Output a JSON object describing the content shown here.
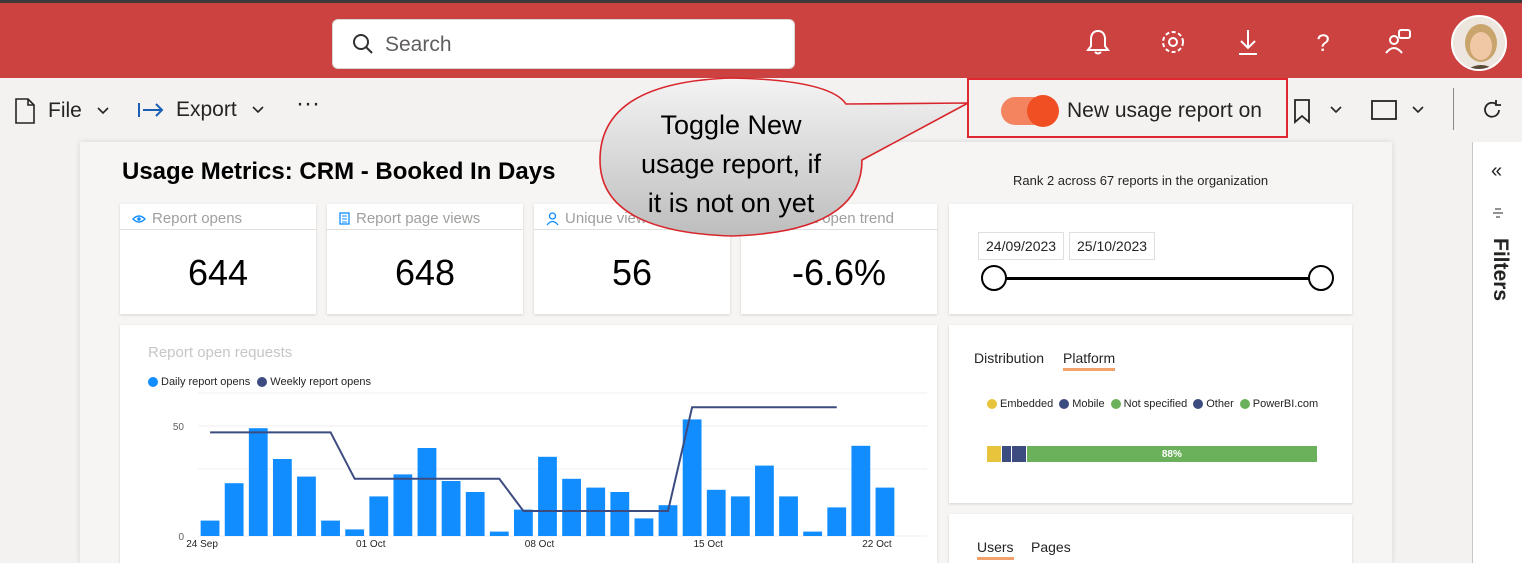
{
  "topbar": {
    "search_placeholder": "Search",
    "icons": [
      "bell-icon",
      "gear-icon",
      "download-icon",
      "help-icon",
      "feedback-icon"
    ],
    "avatar_initials": "",
    "accent_color": "#cc4240"
  },
  "commandbar": {
    "file_label": "File",
    "export_label": "Export",
    "more_label": "···",
    "toggle_label": "New usage report on",
    "toggle_on": true
  },
  "report": {
    "title": "Usage Metrics: CRM - Booked In Days",
    "rank_text": "Rank 2 across 67 reports in the organization",
    "kpis": [
      {
        "label": "Report opens",
        "value": "644",
        "icon": "eye-icon"
      },
      {
        "label": "Report page views",
        "value": "648",
        "icon": "document-icon"
      },
      {
        "label": "Unique viewers",
        "value": "56",
        "icon": "person-icon"
      },
      {
        "label": "Report open trend",
        "value": "-6.6%",
        "icon": "trend-icon"
      }
    ],
    "date_start": "24/09/2023",
    "date_end": "25/10/2023",
    "distribution": {
      "tabs": [
        "Distribution",
        "Platform"
      ],
      "active_tab": "Platform",
      "legend": [
        {
          "name": "Embedded",
          "color": "#e8c43c"
        },
        {
          "name": "Mobile",
          "color": "#3d4c80"
        },
        {
          "name": "Not specified",
          "color": "#6bb15b"
        },
        {
          "name": "Other",
          "color": "#3d4c80"
        },
        {
          "name": "PowerBI.com",
          "color": "#6bb15b"
        }
      ],
      "bar_label": "88%",
      "segments": [
        {
          "name": "Embedded",
          "value": 0.045,
          "color": "#e8c43c"
        },
        {
          "name": "Mobile",
          "value": 0.03,
          "color": "#3d4c80"
        },
        {
          "name": "Other",
          "value": 0.045,
          "color": "#3d4c80"
        },
        {
          "name": "PowerBI.com",
          "value": 0.88,
          "color": "#6bb15b"
        }
      ]
    },
    "users_tabs": [
      "Users",
      "Pages"
    ],
    "users_active_tab": "Users"
  },
  "filters": {
    "label": "Filters",
    "collapse_label": "«"
  },
  "callout": {
    "text_lines": [
      "Toggle New",
      "usage report, if",
      "it is not on yet"
    ]
  },
  "chart_data": {
    "type": "bar",
    "title": "Report open requests",
    "x_tick_labels": [
      "24 Sep",
      "01 Oct",
      "08 Oct",
      "15 Oct",
      "22 Oct"
    ],
    "y_left_ticks": [
      "0",
      "50"
    ],
    "y_right_ticks": [
      "120",
      "140",
      "160"
    ],
    "ylim_left": [
      0,
      50
    ],
    "ylim_right": [
      120,
      160
    ],
    "series": [
      {
        "name": "Daily report opens",
        "color": "#118dff",
        "values": [
          7,
          24,
          49,
          35,
          27,
          7,
          3,
          18,
          28,
          40,
          25,
          20,
          2,
          12,
          36,
          26,
          22,
          20,
          8,
          14,
          53,
          21,
          18,
          32,
          18,
          2,
          13,
          41,
          22
        ]
      },
      {
        "name": "Weekly report opens",
        "color": "#3d4c80",
        "values": [
          149,
          149,
          149,
          149,
          149,
          149,
          136,
          136,
          136,
          136,
          136,
          136,
          136,
          127,
          127,
          127,
          127,
          127,
          127,
          127,
          156,
          156,
          156,
          156,
          156,
          156,
          156
        ]
      }
    ]
  }
}
